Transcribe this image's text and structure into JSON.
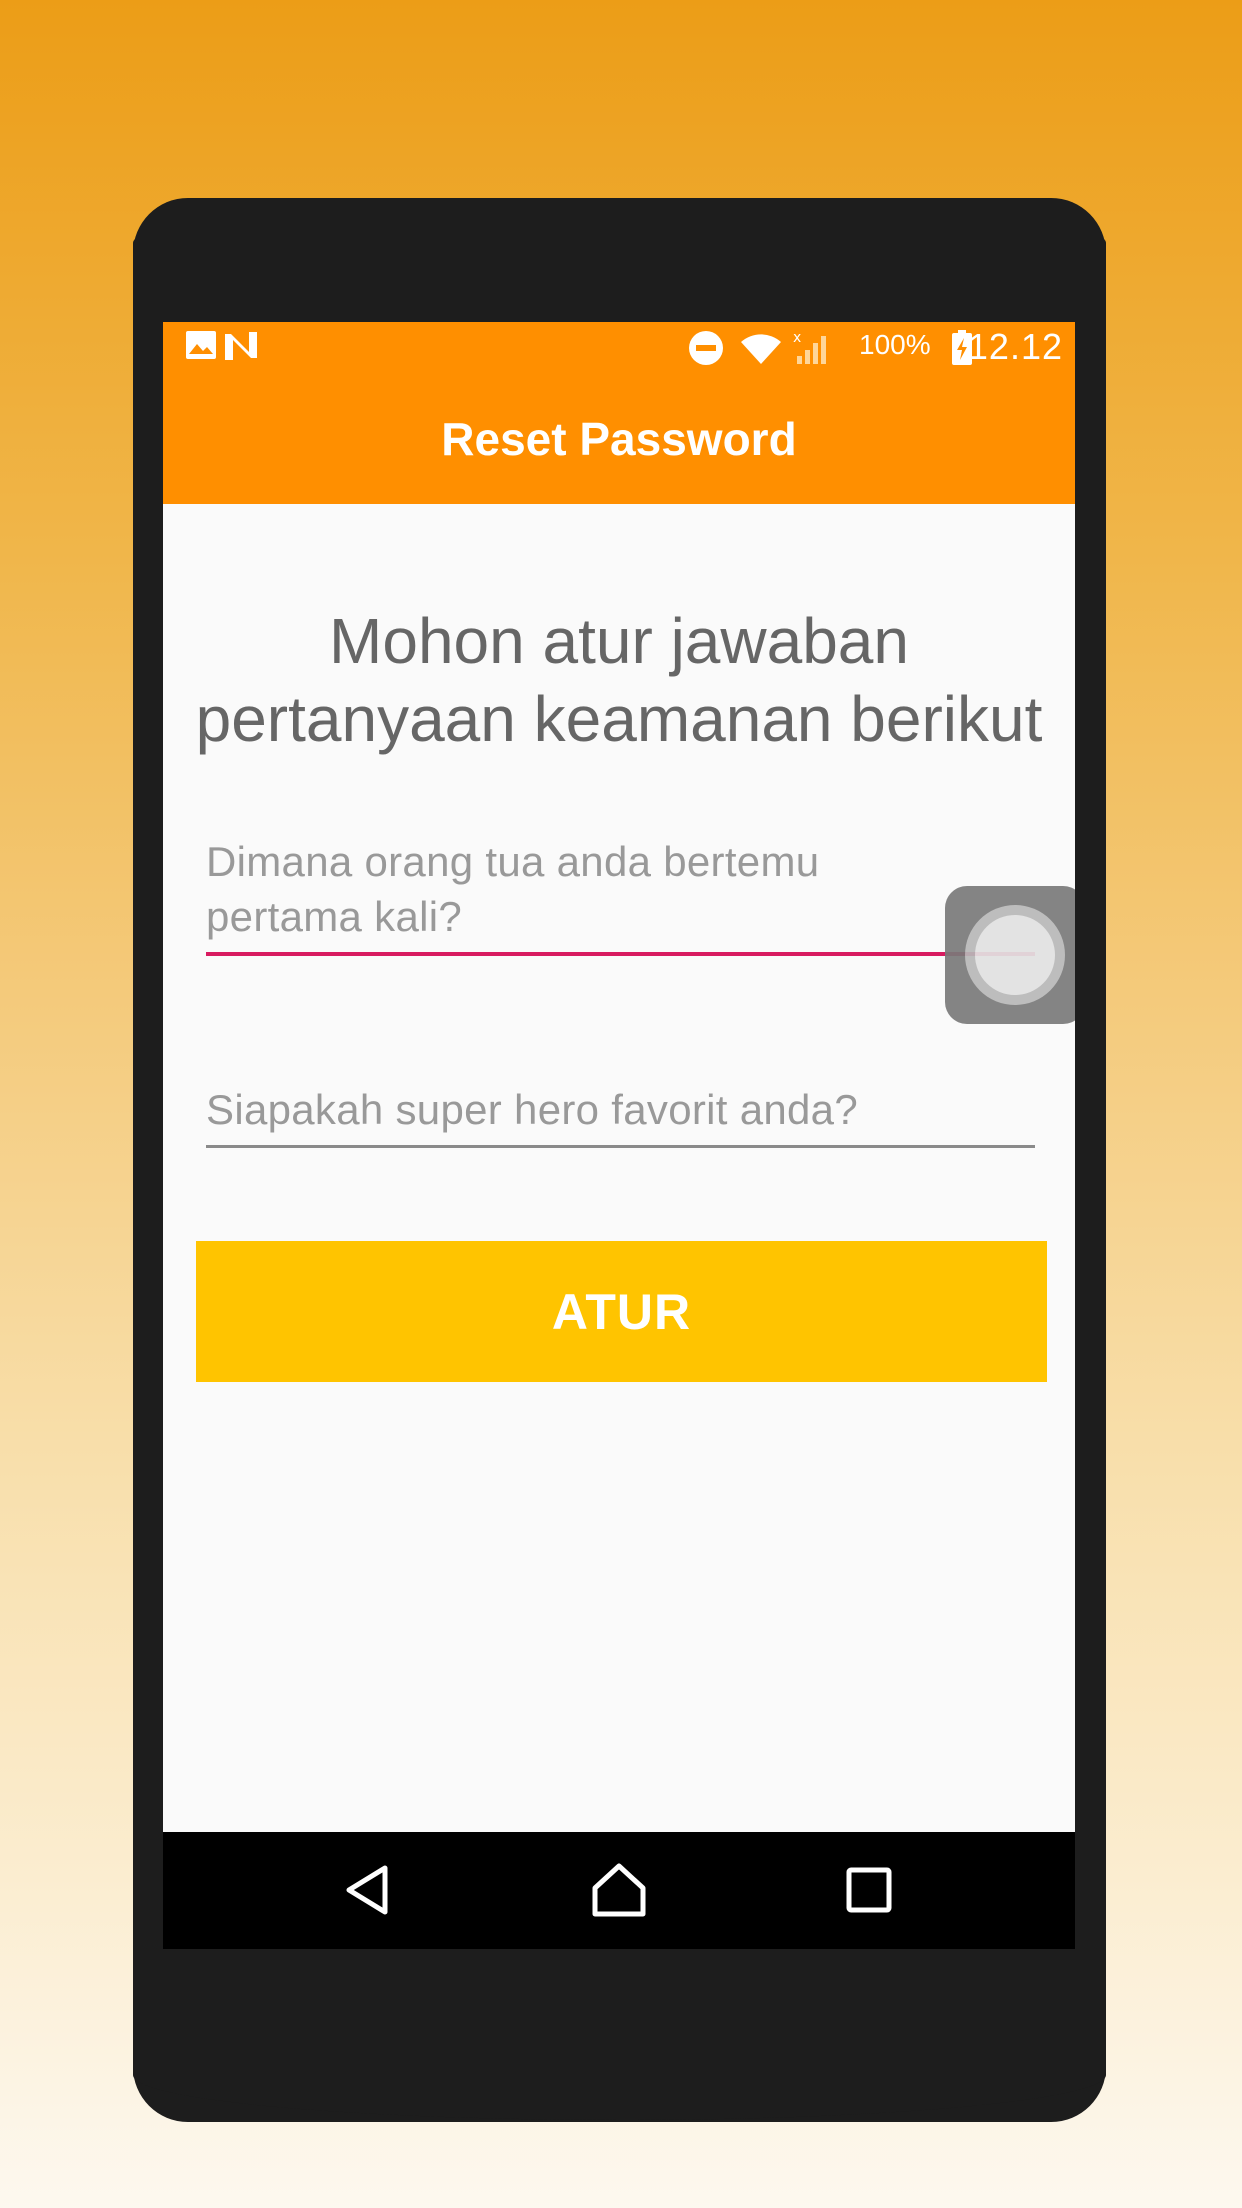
{
  "status_bar": {
    "battery": "100%",
    "time": "12.12",
    "icons": [
      "image-icon",
      "n-logo-icon",
      "do-not-disturb-icon",
      "wifi-icon",
      "signal-icon",
      "battery-charging-icon"
    ]
  },
  "toolbar": {
    "title": "Reset Password",
    "background_color": "#ff8f00"
  },
  "main": {
    "heading_line1": "Mohon atur jawaban",
    "heading_line2": "pertanyaan keamanan berikut",
    "question1": {
      "placeholder_line1": "Dimana orang tua anda bertemu",
      "placeholder_line2": "pertama kali?",
      "focused": true,
      "underline_color": "#d81b60"
    },
    "question2": {
      "placeholder": "Siapakah super hero favorit anda?",
      "focused": false
    },
    "submit_button": {
      "label": "ATUR",
      "color": "#ffc400"
    }
  },
  "floating_widget": {
    "icon": "assistive-touch-icon"
  },
  "nav_bar": {
    "icons": [
      "back-icon",
      "home-icon",
      "recents-icon"
    ]
  }
}
